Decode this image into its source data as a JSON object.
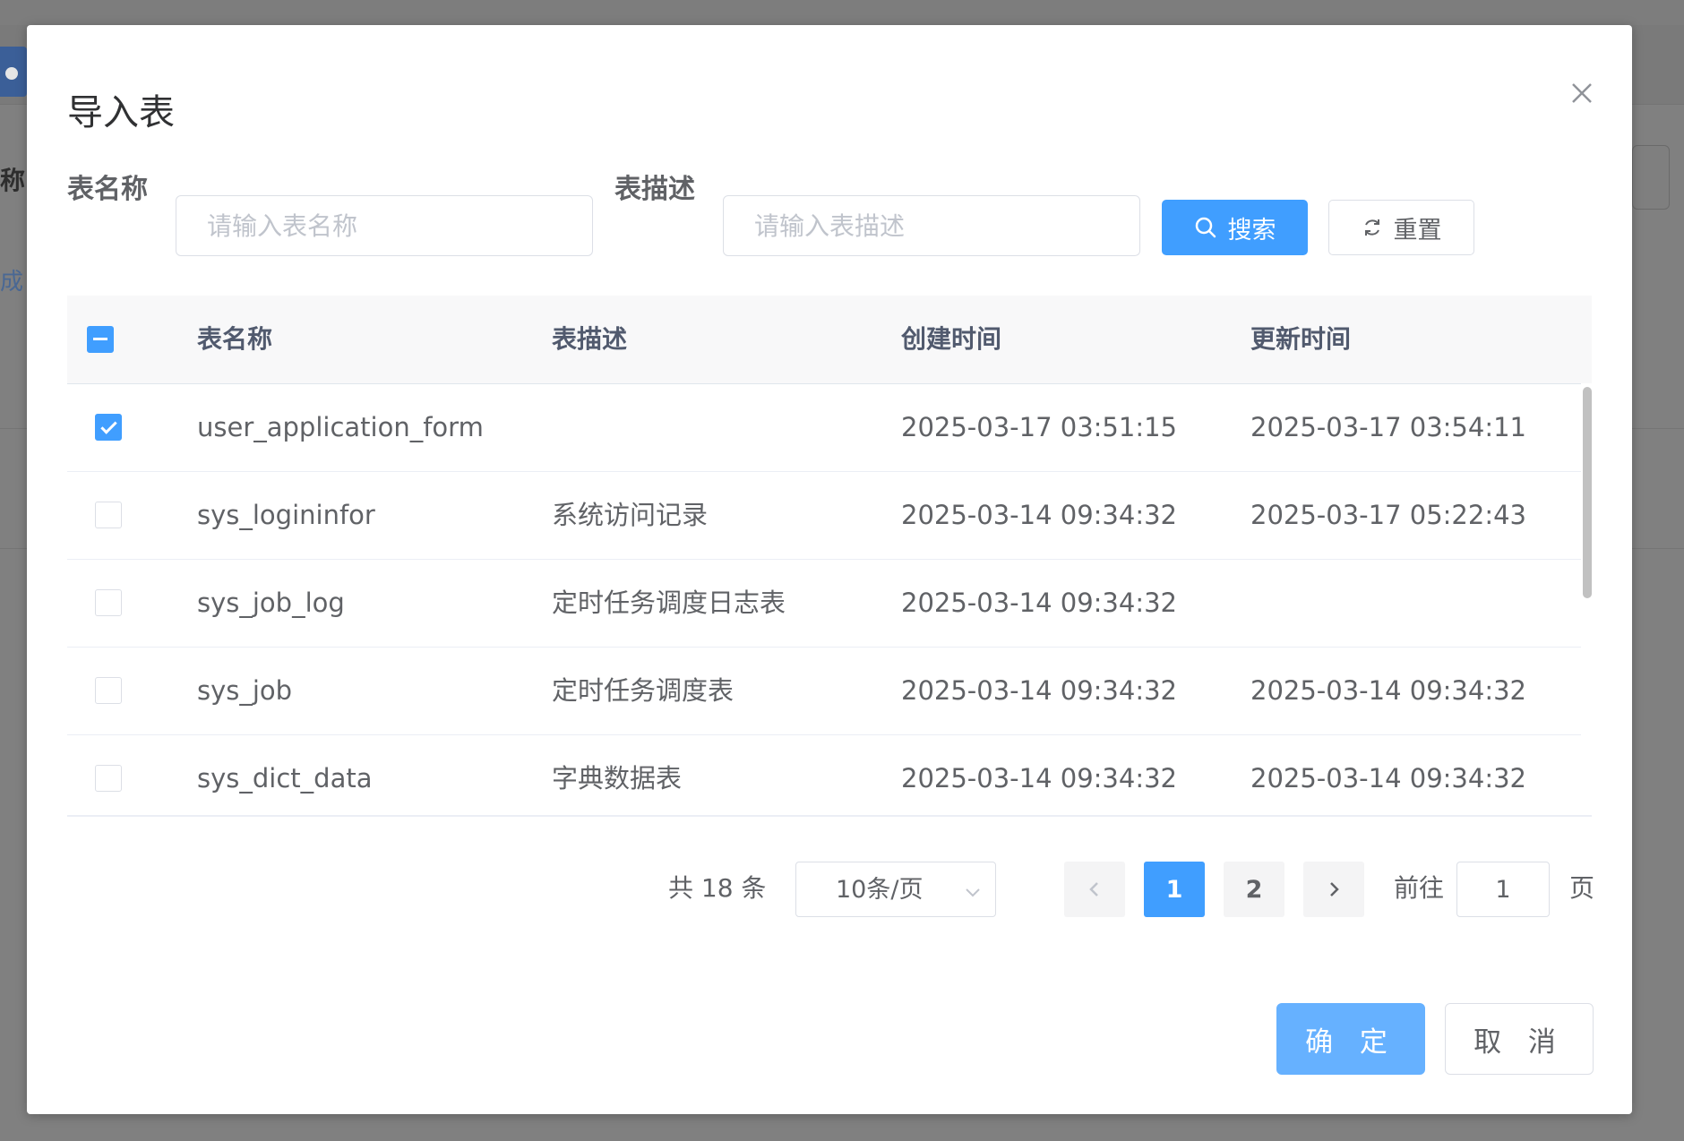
{
  "background": {
    "fragment_label_1": "称",
    "fragment_label_2": "成"
  },
  "dialog": {
    "title": "导入表"
  },
  "search": {
    "table_name_label": "表名称",
    "table_name_placeholder": "请输入表名称",
    "table_desc_label": "表描述",
    "table_desc_placeholder": "请输入表描述",
    "search_button": "搜索",
    "reset_button": "重置"
  },
  "table": {
    "columns": [
      "表名称",
      "表描述",
      "创建时间",
      "更新时间"
    ],
    "header_checkbox_state": "indeterminate",
    "rows": [
      {
        "checked": true,
        "name": "user_application_form",
        "desc": "",
        "created": "2025-03-17 03:51:15",
        "updated": "2025-03-17 03:54:11"
      },
      {
        "checked": false,
        "name": "sys_logininfor",
        "desc": "系统访问记录",
        "created": "2025-03-14 09:34:32",
        "updated": "2025-03-17 05:22:43"
      },
      {
        "checked": false,
        "name": "sys_job_log",
        "desc": "定时任务调度日志表",
        "created": "2025-03-14 09:34:32",
        "updated": ""
      },
      {
        "checked": false,
        "name": "sys_job",
        "desc": "定时任务调度表",
        "created": "2025-03-14 09:34:32",
        "updated": "2025-03-14 09:34:32"
      },
      {
        "checked": false,
        "name": "sys_dict_data",
        "desc": "字典数据表",
        "created": "2025-03-14 09:34:32",
        "updated": "2025-03-14 09:34:32"
      }
    ]
  },
  "pagination": {
    "total_text": "共 18 条",
    "page_size": "10条/页",
    "pages": [
      "1",
      "2"
    ],
    "current_page": "1",
    "goto_label": "前往",
    "goto_value": "1",
    "page_suffix": "页"
  },
  "footer": {
    "confirm_button": "确 定",
    "cancel_button": "取 消"
  },
  "colors": {
    "primary": "#409eff",
    "primary_light": "#66b1ff",
    "overlay": "#808080"
  }
}
